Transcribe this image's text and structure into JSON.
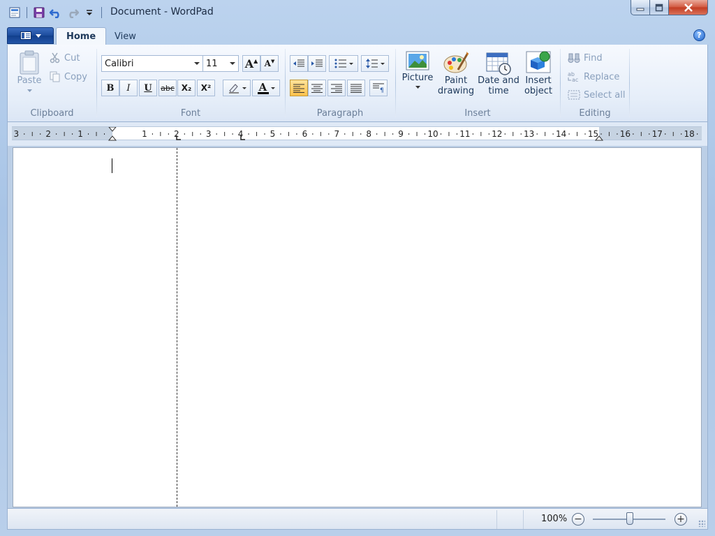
{
  "window": {
    "title": "Document - WordPad",
    "quick_access": [
      "wordpad-app-icon",
      "save-icon",
      "undo-icon",
      "redo-icon",
      "customize-qat-icon"
    ]
  },
  "tabs": [
    {
      "label": "Home",
      "selected": true
    },
    {
      "label": "View",
      "selected": false
    }
  ],
  "ribbon": {
    "clipboard": {
      "label": "Clipboard",
      "paste": "Paste",
      "cut": "Cut",
      "copy": "Copy"
    },
    "font": {
      "label": "Font",
      "family": "Calibri",
      "size": "11",
      "bold": "B",
      "italic": "I",
      "underline": "U",
      "strike": "abc",
      "subscript": "X₂",
      "superscript": "X²",
      "grow": "A",
      "shrink": "A",
      "color_label": "A",
      "font_color": "#000000"
    },
    "paragraph": {
      "label": "Paragraph",
      "active_alignment": "left"
    },
    "insert": {
      "label": "Insert",
      "picture": "Picture",
      "paint_line1": "Paint",
      "paint_line2": "drawing",
      "datetime_line1": "Date and",
      "datetime_line2": "time",
      "object_line1": "Insert",
      "object_line2": "object"
    },
    "editing": {
      "label": "Editing",
      "find": "Find",
      "replace": "Replace",
      "select_all": "Select all"
    }
  },
  "ruler": {
    "labels": [
      "3",
      "2",
      "1",
      "1",
      "2",
      "3",
      "4",
      "5",
      "6",
      "7",
      "8",
      "9",
      "10",
      "11",
      "12",
      "13",
      "14",
      "15",
      "16",
      "17",
      "18"
    ]
  },
  "status": {
    "zoom": "100%",
    "zoom_out": "−",
    "zoom_in": "+"
  },
  "colors": {
    "accent": "#1b4b9c",
    "active_button": "#ffc24a"
  }
}
